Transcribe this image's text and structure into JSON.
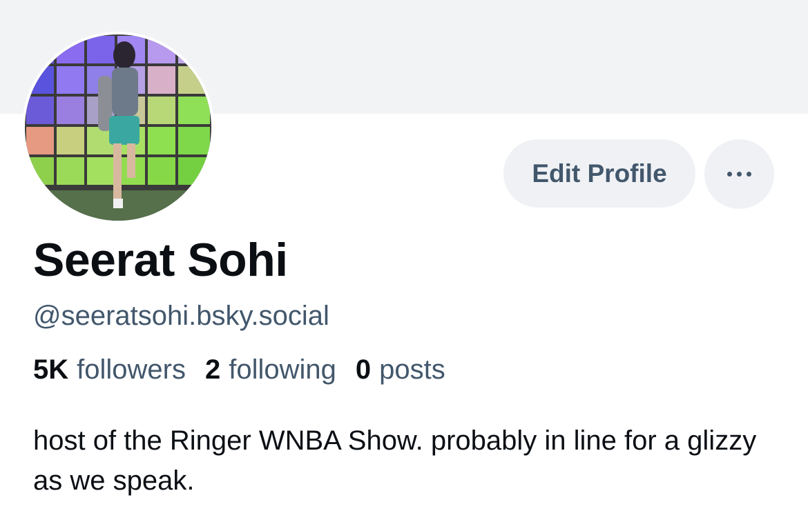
{
  "profile": {
    "display_name": "Seerat Sohi",
    "handle": "@seeratsohi.bsky.social",
    "bio": "host of the Ringer WNBA Show. probably in line for a glizzy as we speak."
  },
  "stats": {
    "followers_count": "5K",
    "followers_label": "followers",
    "following_count": "2",
    "following_label": "following",
    "posts_count": "0",
    "posts_label": "posts"
  },
  "actions": {
    "edit_profile_label": "Edit Profile",
    "more_icon": "ellipsis-icon"
  },
  "colors": {
    "banner": "#f2f3f5",
    "button_bg": "#eff1f4",
    "secondary_text": "#42576c",
    "primary_text": "#0b0f14"
  }
}
